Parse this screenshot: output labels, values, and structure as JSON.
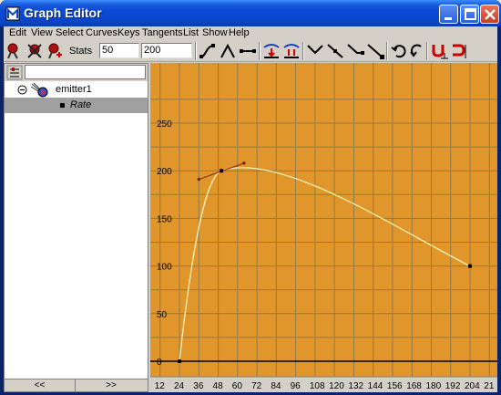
{
  "window": {
    "title": "Graph Editor",
    "buttons": [
      "minimize",
      "maximize",
      "close"
    ]
  },
  "menubar": {
    "items": [
      "Edit",
      "View",
      "Select",
      "Curves",
      "Keys",
      "Tangents",
      "List",
      "Show",
      "Help"
    ]
  },
  "toolbar": {
    "stats_label": "Stats",
    "stat_time": "50",
    "stat_value": "200",
    "icons": [
      "move-key-icon",
      "insert-key-icon",
      "add-key-icon",
      "spline-tangent-icon",
      "linear-tangent-icon",
      "clamped-tangent-icon",
      "flat-tangent-icon",
      "step-tangent-icon",
      "buffer-curve-icon",
      "swap-buffer-icon",
      "break-tangents-icon",
      "unify-tangents-icon",
      "free-tangent-weight-icon",
      "lock-tangent-weight-icon",
      "auto-load-icon",
      "load-selected-icon",
      "snap-time-icon",
      "snap-value-icon"
    ]
  },
  "outliner": {
    "node": "emitter1",
    "attribute": "Rate",
    "scroll_left": "<<",
    "scroll_right": ">>"
  },
  "graph": {
    "background_color": "#e0962a",
    "y_ticks": [
      "250",
      "200",
      "150",
      "100",
      "50",
      "0"
    ],
    "x_ticks": [
      "12",
      "24",
      "36",
      "48",
      "60",
      "72",
      "84",
      "96",
      "108",
      "120",
      "132",
      "144",
      "156",
      "168",
      "180",
      "192",
      "204",
      "21"
    ]
  },
  "chart_data": {
    "type": "line",
    "series": [
      {
        "keys": [
          {
            "x": 24,
            "y": 0
          },
          {
            "x": 50,
            "y": 200
          },
          {
            "x": 204,
            "y": 100
          }
        ]
      }
    ],
    "tangent_handles": [
      {
        "x": 36,
        "y": 191
      },
      {
        "x": 64,
        "y": 208
      }
    ],
    "ylim": [
      -20,
      260
    ],
    "xlim": [
      12,
      216
    ]
  }
}
